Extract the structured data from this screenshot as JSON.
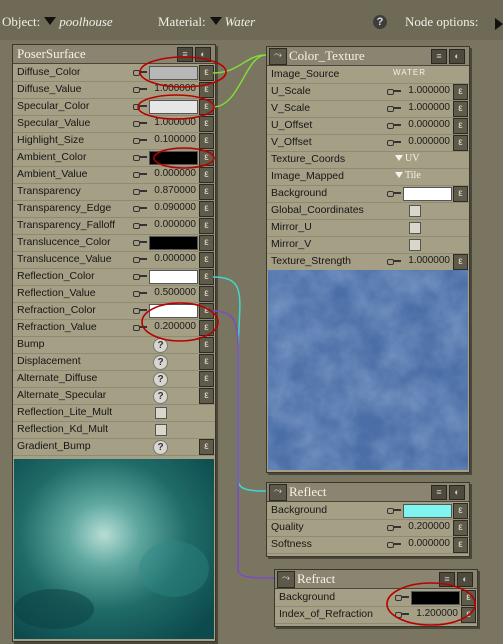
{
  "topbar": {
    "object_label": "Object:",
    "object_value": "poolhouse",
    "material_label": "Material:",
    "material_value": "Water",
    "help_icon": "question-icon",
    "node_options_label": "Node options:"
  },
  "poser_surface": {
    "title": "PoserSurface",
    "rows": [
      {
        "label": "Diffuse_Color",
        "kind": "color",
        "color": "#b7b7b7"
      },
      {
        "label": "Diffuse_Value",
        "kind": "value",
        "value": "1.000000"
      },
      {
        "label": "Specular_Color",
        "kind": "color",
        "color": "#e6e6e6"
      },
      {
        "label": "Specular_Value",
        "kind": "value",
        "value": "1.000000"
      },
      {
        "label": "Highlight_Size",
        "kind": "value",
        "value": "0.100000"
      },
      {
        "label": "Ambient_Color",
        "kind": "color",
        "color": "#000000"
      },
      {
        "label": "Ambient_Value",
        "kind": "value",
        "value": "0.000000"
      },
      {
        "label": "Transparency",
        "kind": "value",
        "value": "0.870000"
      },
      {
        "label": "Transparency_Edge",
        "kind": "value",
        "value": "0.090000"
      },
      {
        "label": "Transparency_Falloff",
        "kind": "value",
        "value": "0.000000"
      },
      {
        "label": "Translucence_Color",
        "kind": "color",
        "color": "#000000"
      },
      {
        "label": "Translucence_Value",
        "kind": "value",
        "value": "0.000000"
      },
      {
        "label": "Reflection_Color",
        "kind": "color",
        "color": "#ffffff"
      },
      {
        "label": "Reflection_Value",
        "kind": "value",
        "value": "0.500000"
      },
      {
        "label": "Refraction_Color",
        "kind": "color",
        "color": "#ffffff"
      },
      {
        "label": "Refraction_Value",
        "kind": "value",
        "value": "0.200000"
      },
      {
        "label": "Bump",
        "kind": "help"
      },
      {
        "label": "Displacement",
        "kind": "help"
      },
      {
        "label": "Alternate_Diffuse",
        "kind": "help"
      },
      {
        "label": "Alternate_Specular",
        "kind": "help"
      },
      {
        "label": "Reflection_Lite_Mult",
        "kind": "check"
      },
      {
        "label": "Reflection_Kd_Mult",
        "kind": "check"
      },
      {
        "label": "Gradient_Bump",
        "kind": "help"
      }
    ]
  },
  "color_texture": {
    "title": "Color_Texture",
    "rows": [
      {
        "label": "Image_Source",
        "kind": "text",
        "value": "WATER"
      },
      {
        "label": "U_Scale",
        "kind": "value",
        "value": "1.000000"
      },
      {
        "label": "V_Scale",
        "kind": "value",
        "value": "1.000000"
      },
      {
        "label": "U_Offset",
        "kind": "value",
        "value": "0.000000"
      },
      {
        "label": "V_Offset",
        "kind": "value",
        "value": "0.000000"
      },
      {
        "label": "Texture_Coords",
        "kind": "dropdown",
        "value": "UV"
      },
      {
        "label": "Image_Mapped",
        "kind": "dropdown",
        "value": "Tile"
      },
      {
        "label": "Background",
        "kind": "color",
        "color": "#ffffff"
      },
      {
        "label": "Global_Coordinates",
        "kind": "check"
      },
      {
        "label": "Mirror_U",
        "kind": "check"
      },
      {
        "label": "Mirror_V",
        "kind": "check"
      },
      {
        "label": "Texture_Strength",
        "kind": "value",
        "value": "1.000000"
      }
    ]
  },
  "reflect": {
    "title": "Reflect",
    "rows": [
      {
        "label": "Background",
        "kind": "color",
        "color": "#7ff5f0"
      },
      {
        "label": "Quality",
        "kind": "value",
        "value": "0.200000"
      },
      {
        "label": "Softness",
        "kind": "value",
        "value": "0.000000"
      }
    ]
  },
  "refract": {
    "title": "Refract",
    "rows": [
      {
        "label": "Background",
        "kind": "color",
        "color": "#000000"
      },
      {
        "label": "Index_of_Refraction",
        "kind": "value",
        "value": "1.200000"
      }
    ]
  },
  "colors": {
    "wire_green": "#7fdc3a",
    "wire_cyan": "#3fd6d0",
    "wire_purple": "#7b4bc8",
    "annotation_red": "#b80000"
  }
}
